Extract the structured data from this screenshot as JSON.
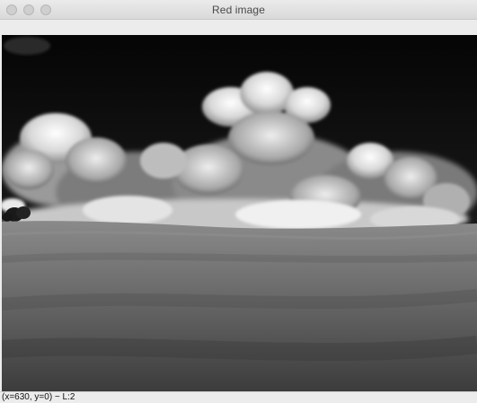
{
  "window": {
    "title": "Red image"
  },
  "icons": {
    "close": "close-button-icon",
    "minimize": "minimize-button-icon",
    "zoom": "zoom-button-icon"
  },
  "image": {
    "description_channel": "grayscale",
    "sky_color": "#0b0b0b",
    "cloud_color": "#e6e6e6",
    "field_color": "#6e6e6e"
  },
  "statusbar": {
    "text": "(x=630, y=0) ~ L:2"
  }
}
